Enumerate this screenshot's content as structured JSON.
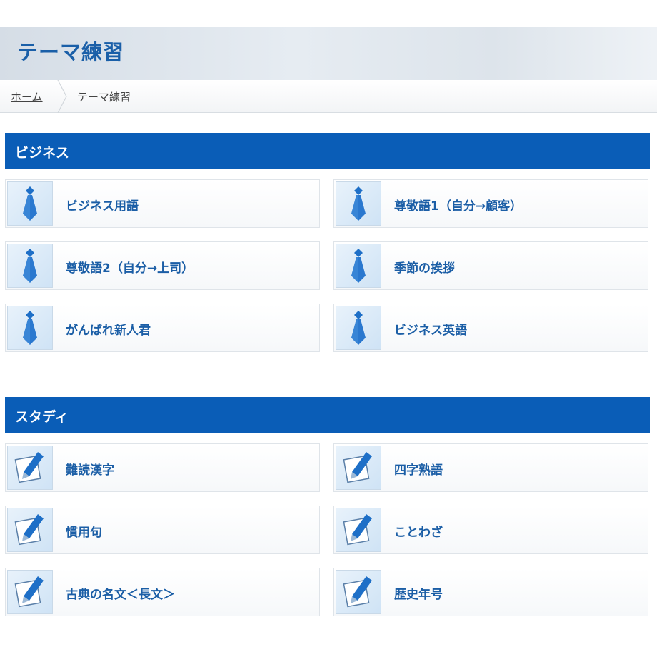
{
  "page": {
    "title": "テーマ練習"
  },
  "breadcrumb": {
    "home": "ホーム",
    "current": "テーマ練習"
  },
  "colors": {
    "header_blue": "#0a5db7",
    "title_blue": "#1a5fa8",
    "label_blue": "#1b5ea6"
  },
  "sections": [
    {
      "title": "ビジネス",
      "icon": "necktie-icon",
      "items": [
        "ビジネス用語",
        "尊敬語1（自分→顧客）",
        "尊敬語2（自分→上司）",
        "季節の挨拶",
        "がんばれ新人君",
        "ビジネス英語"
      ]
    },
    {
      "title": "スタディ",
      "icon": "pencil-icon",
      "items": [
        "難読漢字",
        "四字熟語",
        "慣用句",
        "ことわざ",
        "古典の名文＜長文＞",
        "歴史年号"
      ]
    }
  ]
}
